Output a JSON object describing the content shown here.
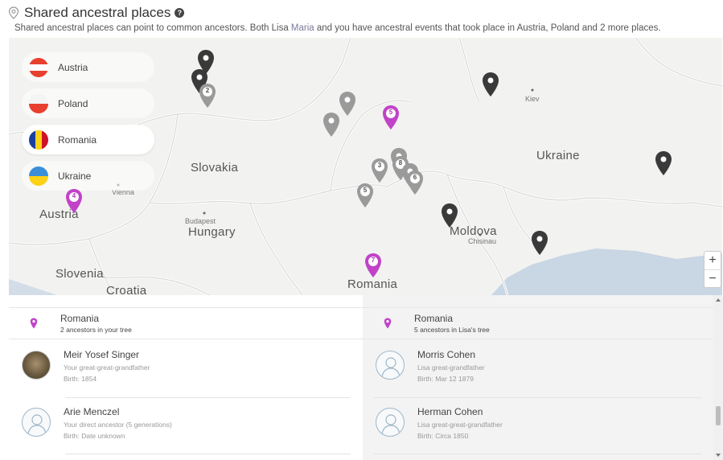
{
  "header": {
    "title": "Shared ancestral places",
    "subtitle_before": "Shared ancestral places can point to common ancestors. Both Lisa",
    "subtitle_name": "Maria",
    "subtitle_after": "and you have ancestral events that took place in Austria, Poland and 2 more places."
  },
  "map": {
    "labels": {
      "austria": "Austria",
      "slovakia": "Slovakia",
      "vienna": "Vienna",
      "budapest": "Budapest",
      "hungary": "Hungary",
      "slovenia": "Slovenia",
      "croatia": "Croatia",
      "romania": "Romania",
      "ukraine": "Ukraine",
      "kiev": "Kiev",
      "moldova": "Moldova",
      "chisinau": "Chisinau"
    },
    "countries": [
      {
        "name": "Austria",
        "flag": "austria-flag",
        "active": false
      },
      {
        "name": "Poland",
        "flag": "poland-flag",
        "active": false
      },
      {
        "name": "Romania",
        "flag": "romania-flag",
        "active": true
      },
      {
        "name": "Ukraine",
        "flag": "ukraine-flag",
        "active": false
      }
    ],
    "pin_numbers": {
      "p2": "2",
      "p5a": "5",
      "p3": "3",
      "p8": "8",
      "p6": "6",
      "p5b": "5",
      "p4": "4",
      "p7": "7"
    },
    "zoom_in": "+",
    "zoom_out": "−",
    "colors": {
      "purple": "#c143c8",
      "dark": "#3a3a3a",
      "grey": "#9a9a9a"
    }
  },
  "left_panel": {
    "place": "Romania",
    "count": "2 ancestors in your tree",
    "people": [
      {
        "name": "Meir Yosef Singer",
        "relation": "Your great-great-grandfather",
        "birth": "Birth: 1854",
        "avatar": "photo"
      },
      {
        "name": "Arie Menczel",
        "relation": "Your direct ancestor (5 generations)",
        "birth": "Birth: Date unknown",
        "avatar": "silhouette-icon"
      }
    ]
  },
  "right_panel": {
    "place": "Romania",
    "count": "5 ancestors in Lisa's tree",
    "people": [
      {
        "name": "Morris Cohen",
        "relation": "Lisa great-grandfather",
        "birth": "Birth: Mar 12 1879",
        "avatar": "silhouette-icon"
      },
      {
        "name": "Herman Cohen",
        "relation": "Lisa great-great-grandfather",
        "birth": "Birth: Circa 1850",
        "avatar": "silhouette-icon"
      }
    ]
  }
}
